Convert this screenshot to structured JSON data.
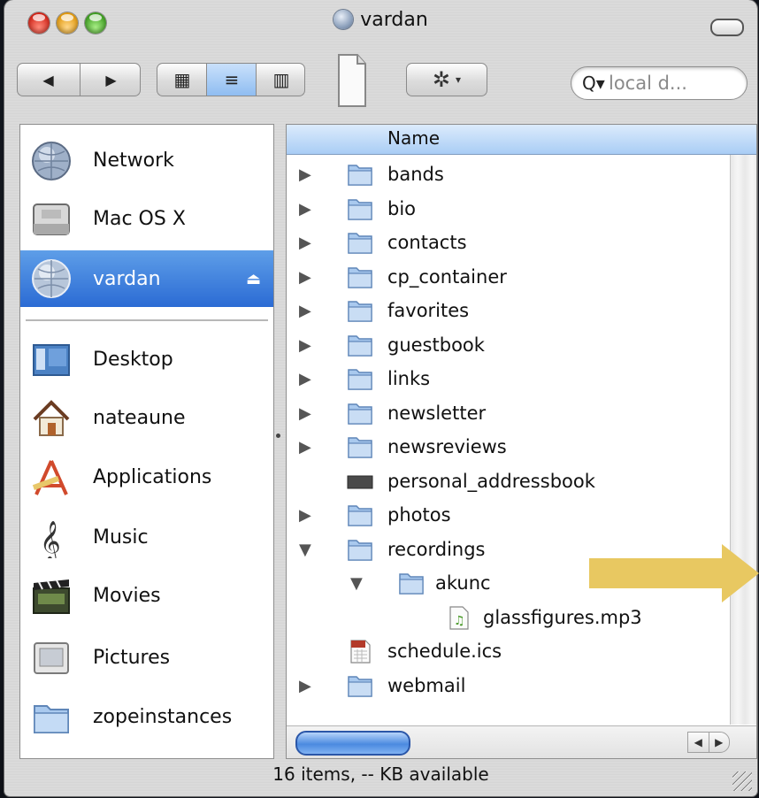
{
  "window": {
    "title": "vardan"
  },
  "toolbar": {
    "back_glyph": "◀",
    "forward_glyph": "▶",
    "view_icons_glyph": "▦",
    "view_list_glyph": "≡",
    "view_columns_glyph": "▥",
    "action_glyph": "✲",
    "action_caret": "▾",
    "search_glyph": "Q▾",
    "search_placeholder": "local d..."
  },
  "sidebar": {
    "items": [
      {
        "label": "Network",
        "icon": "network-globe-icon"
      },
      {
        "label": "Mac OS X",
        "icon": "hard-drive-icon"
      },
      {
        "label": "vardan",
        "icon": "network-volume-icon",
        "selected": true,
        "eject": "⏏"
      },
      {
        "label": "Desktop",
        "icon": "desktop-icon"
      },
      {
        "label": "nateaune",
        "icon": "home-icon"
      },
      {
        "label": "Applications",
        "icon": "applications-icon"
      },
      {
        "label": "Music",
        "icon": "music-icon"
      },
      {
        "label": "Movies",
        "icon": "movies-icon"
      },
      {
        "label": "Pictures",
        "icon": "pictures-icon"
      },
      {
        "label": "zopeinstances",
        "icon": "folder-icon"
      }
    ]
  },
  "list": {
    "column_header": "Name",
    "rows": [
      {
        "name": "bands",
        "type": "folder",
        "disclosure": "▶",
        "level": 0
      },
      {
        "name": "bio",
        "type": "folder",
        "disclosure": "▶",
        "level": 0
      },
      {
        "name": "contacts",
        "type": "folder",
        "disclosure": "▶",
        "level": 0
      },
      {
        "name": "cp_container",
        "type": "folder",
        "disclosure": "▶",
        "level": 0
      },
      {
        "name": "favorites",
        "type": "folder",
        "disclosure": "▶",
        "level": 0
      },
      {
        "name": "guestbook",
        "type": "folder",
        "disclosure": "▶",
        "level": 0
      },
      {
        "name": "links",
        "type": "folder",
        "disclosure": "▶",
        "level": 0
      },
      {
        "name": "newsletter",
        "type": "folder",
        "disclosure": "▶",
        "level": 0
      },
      {
        "name": "newsreviews",
        "type": "folder",
        "disclosure": "▶",
        "level": 0
      },
      {
        "name": "personal_addressbook",
        "type": "file-dark",
        "disclosure": "",
        "level": 0
      },
      {
        "name": "photos",
        "type": "folder",
        "disclosure": "▶",
        "level": 0
      },
      {
        "name": "recordings",
        "type": "folder",
        "disclosure": "▼",
        "level": 0
      },
      {
        "name": "akunc",
        "type": "folder",
        "disclosure": "▼",
        "level": 1
      },
      {
        "name": "glassfigures.mp3",
        "type": "mp3",
        "disclosure": "",
        "level": 2
      },
      {
        "name": "schedule.ics",
        "type": "calendar",
        "disclosure": "",
        "level": 0
      },
      {
        "name": "webmail",
        "type": "folder",
        "disclosure": "▶",
        "level": 0
      }
    ]
  },
  "scroll": {
    "left_arrow": "◀",
    "right_arrow": "▶"
  },
  "status": {
    "text": "16 items, -- KB available"
  },
  "colors": {
    "selection": "#3a7ad8",
    "folder": "#a9c9ee",
    "arrow": "#e8c861",
    "header": "#a9cdf5"
  }
}
